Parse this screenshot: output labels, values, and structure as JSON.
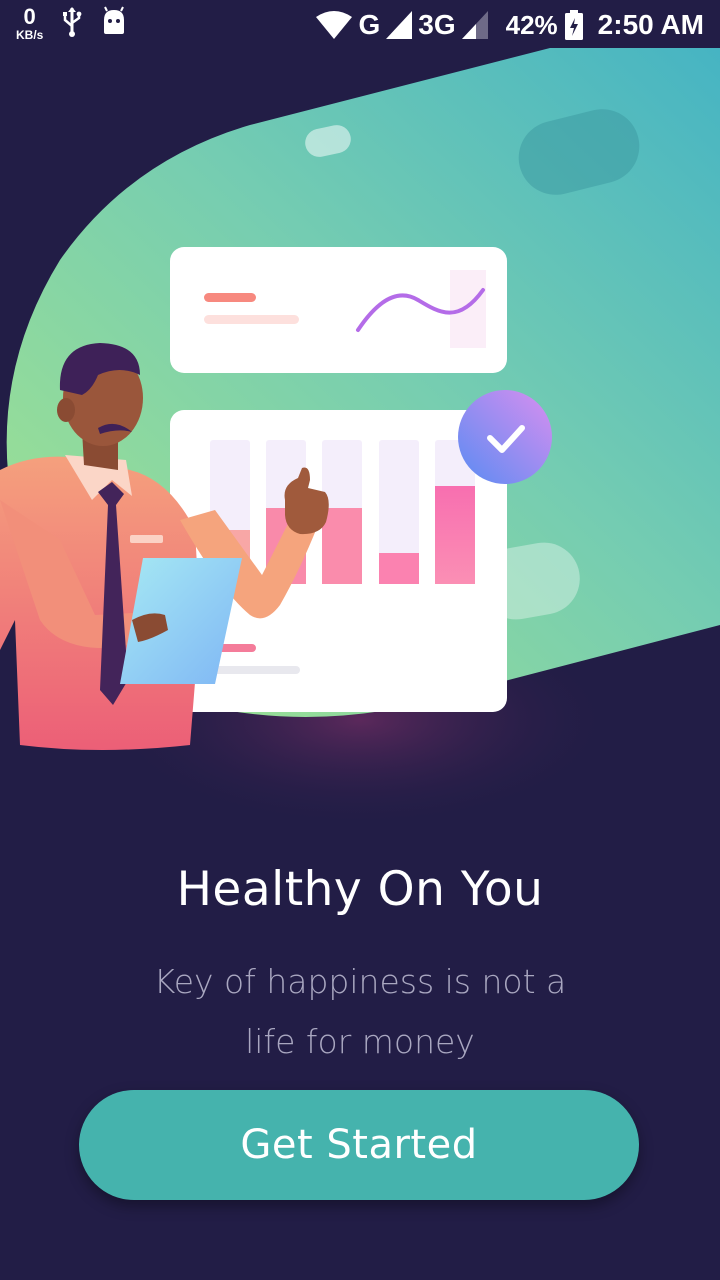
{
  "status_bar": {
    "net_speed_value": "0",
    "net_speed_unit": "KB/s",
    "network_g": "G",
    "network_3g": "3G",
    "battery_percent": "42%",
    "time": "2:50 AM"
  },
  "onboarding": {
    "title": "Healthy On You",
    "subtitle_line1": "Key of happiness is not a",
    "subtitle_line2": "life for money",
    "cta_label": "Get Started"
  },
  "colors": {
    "background": "#221d46",
    "accent": "#45b3ad",
    "blob_start": "#9ee08e",
    "blob_end": "#46b4c3"
  }
}
